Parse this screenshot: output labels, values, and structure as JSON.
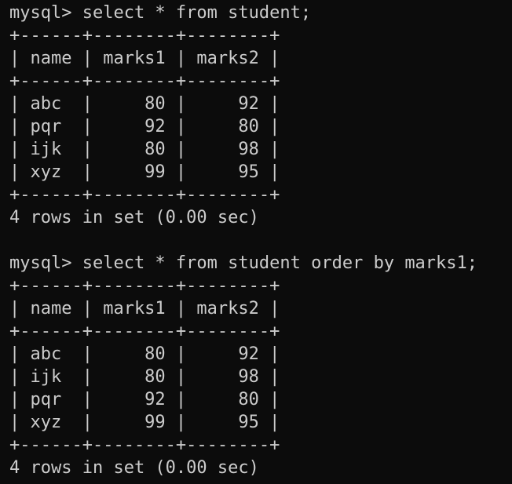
{
  "terminal": {
    "lines": [
      "mysql> select * from student;",
      "+------+--------+--------+",
      "| name | marks1 | marks2 |",
      "+------+--------+--------+",
      "| abc  |     80 |     92 |",
      "| pqr  |     92 |     80 |",
      "| ijk  |     80 |     98 |",
      "| xyz  |     99 |     95 |",
      "+------+--------+--------+",
      "4 rows in set (0.00 sec)",
      "",
      "mysql> select * from student order by marks1;",
      "+------+--------+--------+",
      "| name | marks1 | marks2 |",
      "+------+--------+--------+",
      "| abc  |     80 |     92 |",
      "| ijk  |     80 |     98 |",
      "| pqr  |     92 |     80 |",
      "| xyz  |     99 |     95 |",
      "+------+--------+--------+",
      "4 rows in set (0.00 sec)"
    ],
    "colors": {
      "background": "#0c0c0c",
      "text": "#cccccc"
    }
  }
}
